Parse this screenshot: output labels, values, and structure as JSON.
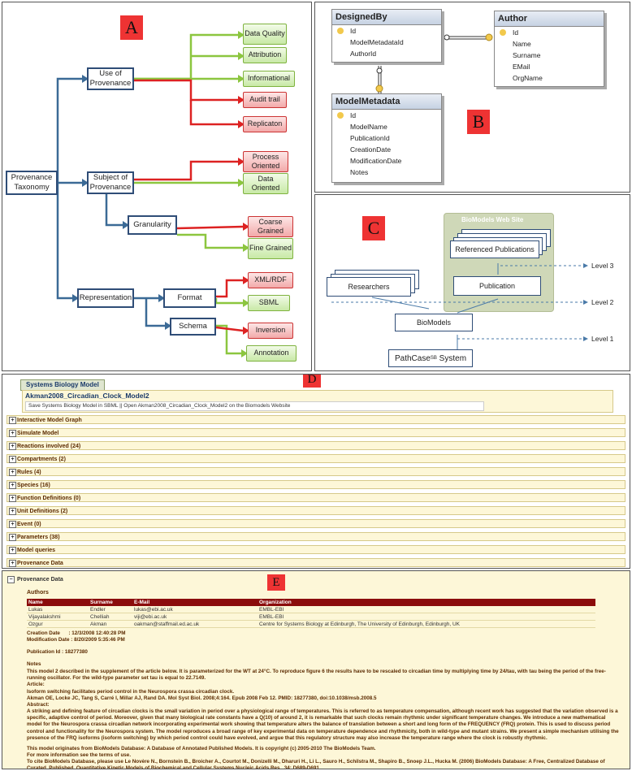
{
  "panel_a": {
    "label": "A",
    "root": "Provenance Taxonomy",
    "use": "Use of Provenance",
    "subject": "Subject of Provenance",
    "granularity": "Granularity",
    "representation": "Representation",
    "format": "Format",
    "schema": "Schema",
    "data_quality": "Data Quality",
    "attribution": "Attribution",
    "informational": "Informational",
    "audit_trail": "Audit trail",
    "replication": "Replicaton",
    "process_oriented": "Process Oriented",
    "data_oriented": "Data Oriented",
    "coarse_grained": "Coarse Grained",
    "fine_grained": "Fine Grained",
    "xml_rdf": "XML/RDF",
    "sbml": "SBML",
    "inversion": "Inversion",
    "annotation": "Annotation",
    "colors": {
      "green": "#8cc63f",
      "red": "#d22",
      "blue": "#3b6a96"
    }
  },
  "panel_b": {
    "label": "B",
    "designed_by": {
      "title": "DesignedBy",
      "fields": [
        "Id",
        "ModelMetadataId",
        "AuthorId"
      ]
    },
    "author": {
      "title": "Author",
      "fields": [
        "Id",
        "Name",
        "Surname",
        "EMail",
        "OrgName"
      ]
    },
    "model_metadata": {
      "title": "ModelMetadata",
      "fields": [
        "Id",
        "ModelName",
        "PublicationId",
        "CreationDate",
        "ModificationDate",
        "Notes"
      ]
    }
  },
  "panel_c": {
    "label": "C",
    "website": "BioModels Web Site",
    "referenced_publications": "Referenced Publications",
    "publication": "Publication",
    "researchers": "Researchers",
    "biomodels": "BioModels",
    "pathcase": "PathCase",
    "pathcase_sup": "SB",
    "pathcase_suffix": " System",
    "level1": "Level 1",
    "level2": "Level 2",
    "level3": "Level 3"
  },
  "panel_d": {
    "label": "D",
    "tab": "Systems Biology Model",
    "model_title": "Akman2008_Circadian_Clock_Model2",
    "links": "Save Systems Biology Model in SBML || Open Akman2008_Circadian_Clock_Model2 on the Biomodels Website",
    "sections": [
      "Interactive Model Graph",
      "Simulate Model",
      "Reactions involved (24)",
      "Compartments (2)",
      "Rules (4)",
      "Species (16)",
      "Function Definitions (0)",
      "Unit Definitions (2)",
      "Event (0)",
      "Parameters (38)",
      "Model queries",
      "Provenance Data"
    ]
  },
  "panel_e": {
    "label": "E",
    "header": "Provenance Data",
    "authors_label": "Authors",
    "columns": [
      "Name",
      "Surname",
      "E-Mail",
      "Organization"
    ],
    "rows": [
      [
        "Lukas",
        "Endler",
        "lukas@ebi.ac.uk",
        "EMBL-EBI"
      ],
      [
        "Vijayalakshmi",
        "Chelliah",
        "viji@ebi.ac.uk",
        "EMBL-EBI"
      ],
      [
        "Ozgur",
        "Akman",
        "oakman@staffmail.ed.ac.uk",
        "Centre for Systems Biology at Edinburgh, The University of Edinburgh, Edinburgh, UK"
      ]
    ],
    "creation_date": "Creation Date      : 12/3/2008 12:40:28 PM",
    "modification_date": "Modification Date : 8/20/2009 5:35:46 PM",
    "publication_id": "Publication Id : 18277380",
    "notes_label": "Notes",
    "notes_p1": "This model 2 described in the supplement of the article below. It is parameterized for the WT at 24°C. To reproduce figure 6 the results have to be rescaled to circadian time by multiplying time by 24/tau, with tau being the period of the free-running oscillator. For the wild-type parameter set tau is equal to 22.7149.",
    "article_label": "Article:",
    "article_title": "Isoform switching facilitates period control in the Neurospora crassa circadian clock.",
    "article_ref": "Akman OE, Locke JC, Tang S, Carré I, Millar AJ, Rand DA. Mol Syst Biol. 2008;4:164. Epub 2008 Feb 12. PMID: 18277380, doi:10.1038/msb.2008.5",
    "abstract_label": "Abstract:",
    "abstract": "A striking and defining feature of circadian clocks is the small variation in period over a physiological range of temperatures. This is referred to as temperature compensation, although recent work has suggested that the variation observed is a specific, adaptive control of period. Moreover, given that many biological rate constants have a Q(10) of around 2, it is remarkable that such clocks remain rhythmic under significant temperature changes. We introduce a new mathematical model for the Neurospora crassa circadian network incorporating experimental work showing that temperature alters the balance of translation between a short and long form of the FREQUENCY (FRQ) protein. This is used to discuss period control and functionality for the Neurospora system. The model reproduces a broad range of key experimental data on temperature dependence and rhythmicity, both in wild-type and mutant strains. We present a simple mechanism utilising the presence of the FRQ isoforms (isoform switching) by which period control could have evolved, and argue that this regulatory structure may also increase the temperature range where the clock is robustly rhythmic.",
    "origin": "This model originates from BioModels Database: A Database of Annotated Published Models. It is copyright (c) 2005-2010 The BioModels Team.",
    "more_info": "For more information see the terms of use.",
    "cite": "To cite BioModels Database, please use Le Novère N., Bornstein B., Broicher A., Courtot M., Donizelli M., Dharuri H., Li L., Sauro H., Schilstra M., Shapiro B., Snoep J.L., Hucka M. (2006) BioModels Database: A Free, Centralized Database of Curated, Published, Quantitative Kinetic Models of Biochemical and Cellular Systems Nucleic Acids Res., 34: D689-D691."
  }
}
